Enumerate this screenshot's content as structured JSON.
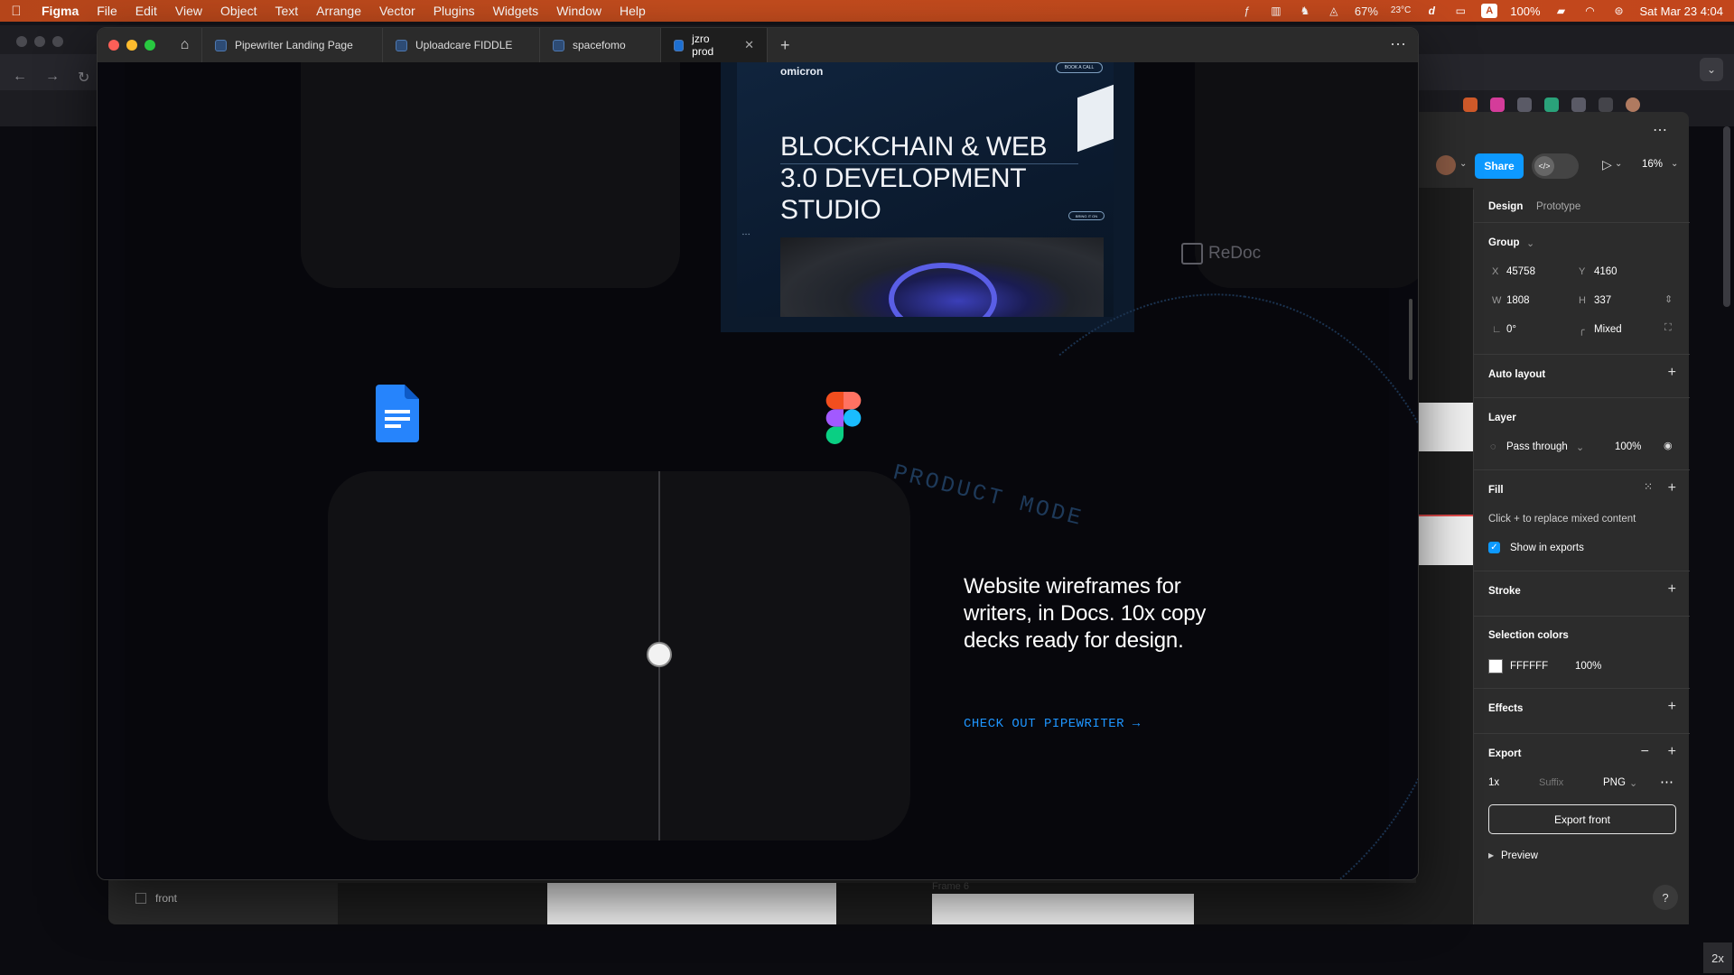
{
  "menubar": {
    "app": "Figma",
    "menus": [
      "File",
      "Edit",
      "View",
      "Object",
      "Text",
      "Arrange",
      "Vector",
      "Plugins",
      "Widgets",
      "Window",
      "Help"
    ],
    "zoom_percent": "67%",
    "temp": "23°C",
    "battery": "100%",
    "datetime": "Sat Mar 23  4:04"
  },
  "tabs": [
    {
      "label": "Pipewriter Landing Page"
    },
    {
      "label": "Uploadcare FIDDLE"
    },
    {
      "label": "spacefomo"
    },
    {
      "label": "jzro prod"
    }
  ],
  "page": {
    "omicron_logo": "omicron",
    "omicron_btn": "BOOK A CALL",
    "omicron_title": "BLOCKCHAIN & WEB 3.0 DEVELOPMENT STUDIO",
    "omicron_pill": "BRING IT ON",
    "redoc": "ReDoc",
    "product_mode": "PRODUCT MODE",
    "headline": "Website wireframes for writers, in Docs. 10x copy decks ready for design.",
    "cta": "CHECK OUT PIPEWRITER →"
  },
  "figma_panel": {
    "share": "Share",
    "zoom": "16%",
    "tabs": [
      "Design",
      "Prototype"
    ],
    "group_label": "Group",
    "x_label": "X",
    "x": "45758",
    "y_label": "Y",
    "y": "4160",
    "w_label": "W",
    "w": "1808",
    "h_label": "H",
    "h": "337",
    "rotation": "0°",
    "radius": "Mixed",
    "auto_layout": "Auto layout",
    "layer": "Layer",
    "blend": "Pass through",
    "opacity": "100%",
    "fill": "Fill",
    "fill_hint": "Click + to replace mixed content",
    "show_in_exports": "Show in exports",
    "stroke": "Stroke",
    "selection_colors": "Selection colors",
    "sel_color_hex": "FFFFFF",
    "sel_color_opacity": "100%",
    "effects": "Effects",
    "export": "Export",
    "export_scale": "1x",
    "export_suffix": "Suffix",
    "export_format": "PNG",
    "export_button": "Export front",
    "preview": "Preview",
    "help": "?"
  },
  "layers": {
    "row1": "front",
    "frame_label": "Frame 6"
  },
  "colors": {
    "accent_blue": "#0d99ff",
    "cta_blue": "#1e95ff",
    "menubar": "#c2461c"
  },
  "corner_badge": "2x"
}
